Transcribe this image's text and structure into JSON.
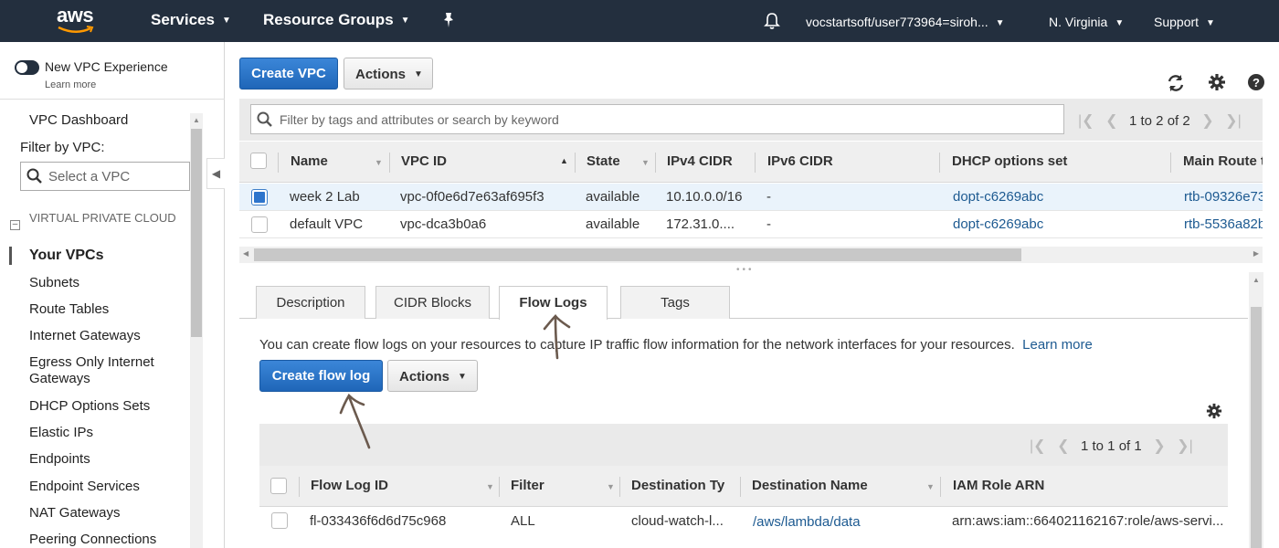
{
  "topnav": {
    "logo": "aws",
    "services": "Services",
    "resource_groups": "Resource Groups",
    "account": "vocstartsoft/user773964=siroh...",
    "region": "N. Virginia",
    "support": "Support",
    "icons": [
      "pin-icon",
      "bell-icon"
    ]
  },
  "sidebar": {
    "new_vpc_experience": "New VPC Experience",
    "learn_more": "Learn more",
    "dashboard": "VPC Dashboard",
    "filter_label": "Filter by VPC:",
    "filter_placeholder": "Select a VPC",
    "section": "VIRTUAL PRIVATE CLOUD",
    "items": [
      "Your VPCs",
      "Subnets",
      "Route Tables",
      "Internet Gateways",
      "Egress Only Internet Gateways",
      "DHCP Options Sets",
      "Elastic IPs",
      "Endpoints",
      "Endpoint Services",
      "NAT Gateways",
      "Peering Connections"
    ],
    "active_item": "Your VPCs"
  },
  "toolbar": {
    "create_vpc": "Create VPC",
    "actions": "Actions"
  },
  "vpc_filter": {
    "placeholder": "Filter by tags and attributes or search by keyword",
    "pagination": "1 to 2 of 2"
  },
  "vpc_table": {
    "columns": [
      "Name",
      "VPC ID",
      "State",
      "IPv4 CIDR",
      "IPv6 CIDR",
      "DHCP options set",
      "Main Route t"
    ],
    "rows": [
      {
        "name": "week 2 Lab",
        "vpc_id": "vpc-0f0e6d7e63af695f3",
        "state": "available",
        "ipv4": "10.10.0.0/16",
        "ipv6": "-",
        "dhcp": "dopt-c6269abc",
        "route": "rtb-09326e73",
        "selected": true
      },
      {
        "name": "default VPC",
        "vpc_id": "vpc-dca3b0a6",
        "state": "available",
        "ipv4": "172.31.0....",
        "ipv6": "-",
        "dhcp": "dopt-c6269abc",
        "route": "rtb-5536a82b",
        "selected": false
      }
    ]
  },
  "tabs": [
    "Description",
    "CIDR Blocks",
    "Flow Logs",
    "Tags"
  ],
  "active_tab": "Flow Logs",
  "flow_logs": {
    "description": "You can create flow logs on your resources to capture IP traffic flow information for the network interfaces for your resources.",
    "learn_more": "Learn more",
    "create_button": "Create flow log",
    "actions": "Actions",
    "pagination": "1 to 1 of 1",
    "columns": [
      "Flow Log ID",
      "Filter",
      "Destination Ty",
      "Destination Name",
      "IAM Role ARN"
    ],
    "rows": [
      {
        "id": "fl-033436f6d6d75c968",
        "filter": "ALL",
        "dest_type": "cloud-watch-l...",
        "dest_name": "/aws/lambda/data",
        "iam_role": "arn:aws:iam::664021162167:role/aws-servi..."
      }
    ]
  }
}
